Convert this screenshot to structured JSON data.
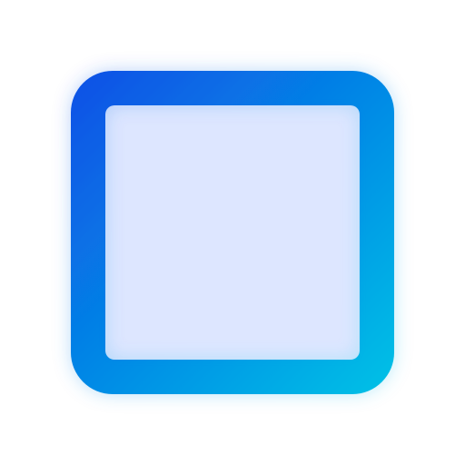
{
  "icon": {
    "name": "square-outline-icon",
    "gradient_start": "#0a4fe6",
    "gradient_end": "#00c2e6",
    "glow_color": "#2f6bff",
    "background": "#ffffff"
  }
}
